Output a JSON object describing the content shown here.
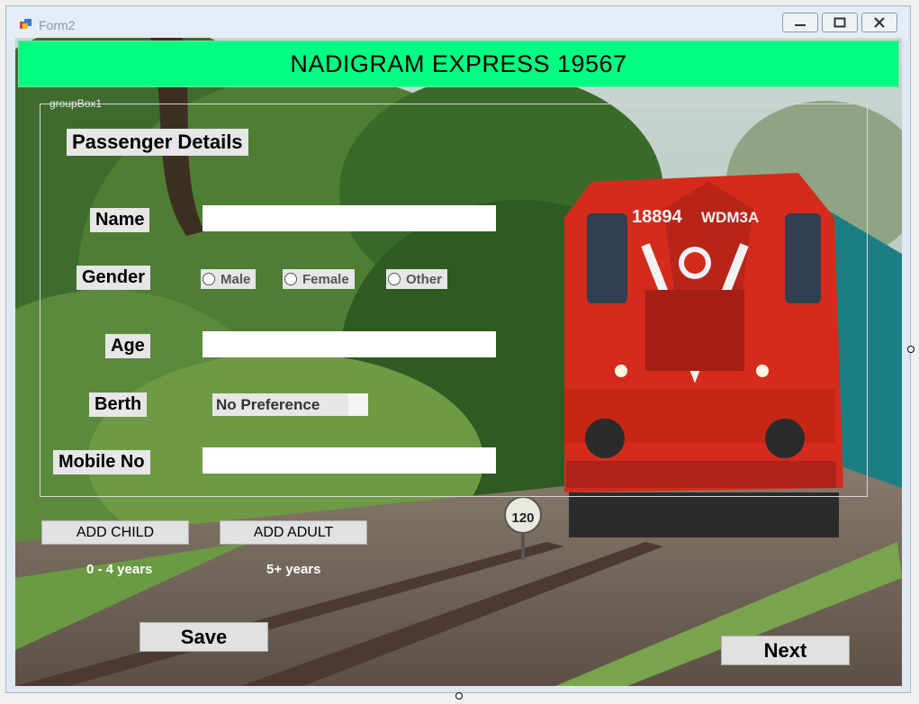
{
  "window": {
    "title": "Form2"
  },
  "banner": {
    "title": "NADIGRAM EXPRESS 19567"
  },
  "groupbox": {
    "title": "groupBox1"
  },
  "form": {
    "heading": "Passenger Details",
    "name_label": "Name",
    "name_value": "",
    "gender_label": "Gender",
    "gender_options": [
      "Male",
      "Female",
      "Other"
    ],
    "age_label": "Age",
    "age_value": "",
    "berth_label": "Berth",
    "berth_selected": "No Preference",
    "mobile_label": "Mobile No",
    "mobile_value": ""
  },
  "buttons": {
    "add_child": "ADD CHILD",
    "add_adult": "ADD ADULT",
    "save": "Save",
    "next": "Next"
  },
  "notes": {
    "child_age": "0 - 4 years",
    "adult_age": "5+ years"
  },
  "scene": {
    "locomotive_number": "18894",
    "locomotive_class": "WDM3A",
    "speed_sign": "120"
  },
  "colors": {
    "banner": "#00ff80",
    "locomotive": "#d42b1c"
  }
}
